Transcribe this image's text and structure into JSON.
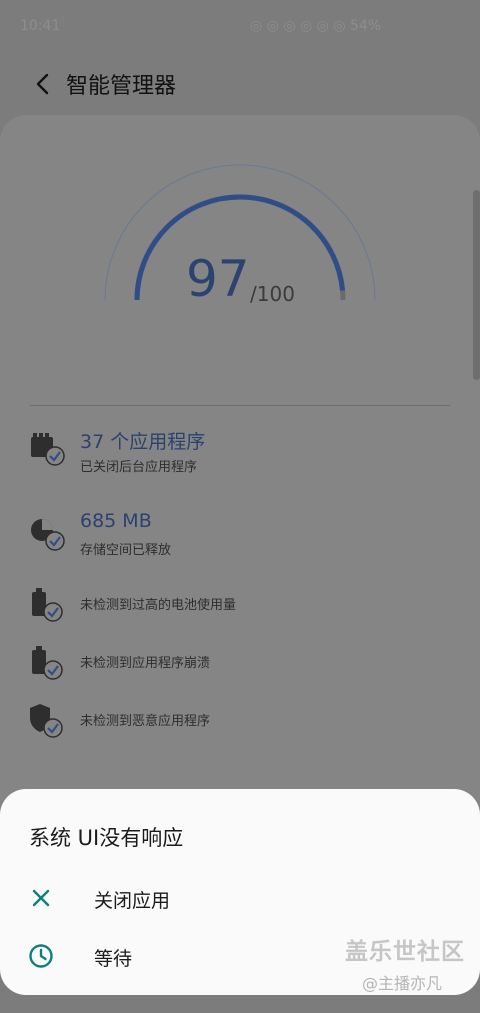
{
  "status_bar": {
    "time": "10:41",
    "right_text": "◎ ◎ ◎ ◎ ◎ ◎ 54%"
  },
  "header": {
    "title": "智能管理器",
    "back_icon": "chevron-left-icon"
  },
  "score": {
    "value": "97",
    "max": "/100",
    "fraction": 0.97,
    "accent_color": "#2f4e87"
  },
  "results": [
    {
      "title": "37 个应用程序",
      "subtitle": "已关闭后台应用程序",
      "icon": "apps-check-icon"
    },
    {
      "title": "685 MB",
      "subtitle": "存储空间已释放",
      "icon": "storage-check-icon"
    },
    {
      "text": "未检测到过高的电池使用量",
      "icon": "battery-check-icon"
    },
    {
      "text": "未检测到应用程序崩溃",
      "icon": "battery-check-icon"
    },
    {
      "text": "未检测到恶意应用程序",
      "icon": "shield-check-icon"
    }
  ],
  "dialog": {
    "title": "系统 UI没有响应",
    "options": [
      {
        "label": "关闭应用",
        "icon": "close-icon"
      },
      {
        "label": "等待",
        "icon": "clock-icon"
      }
    ],
    "icon_color": "#0f7f7a"
  },
  "watermark": {
    "main": "盖乐世社区",
    "sub": "@主播亦凡"
  }
}
